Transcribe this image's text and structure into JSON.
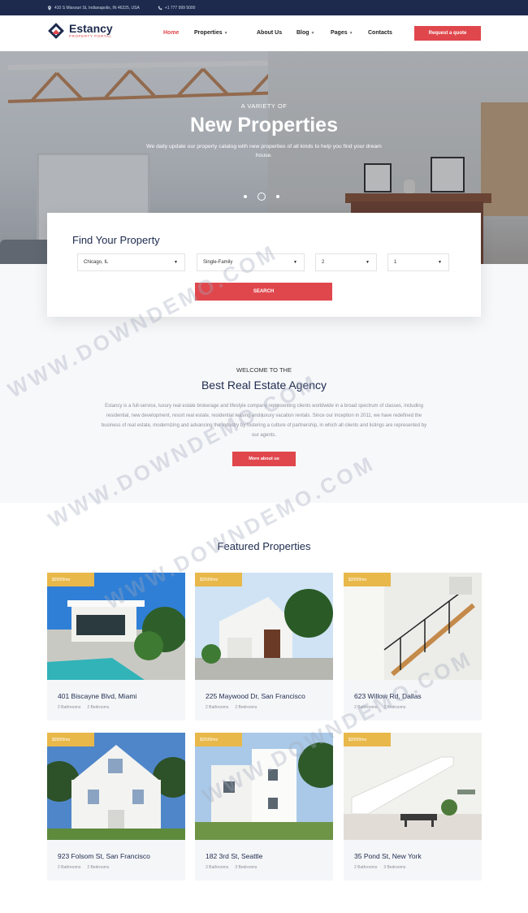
{
  "topbar": {
    "address": "410 S Missouri St, Indianapolis, IN 46225, USA",
    "phone": "+1 777 999 5000"
  },
  "header": {
    "logo_name": "Estancy",
    "logo_sub": "PROPERTY PORTAL",
    "nav": [
      {
        "label": "Home",
        "active": true,
        "dropdown": false
      },
      {
        "label": "Properties",
        "active": false,
        "dropdown": true
      },
      {
        "label": "About Us",
        "active": false,
        "dropdown": false
      },
      {
        "label": "Blog",
        "active": false,
        "dropdown": true
      },
      {
        "label": "Pages",
        "active": false,
        "dropdown": true
      },
      {
        "label": "Contacts",
        "active": false,
        "dropdown": false
      }
    ],
    "cta_label": "Request a quote"
  },
  "hero": {
    "eyebrow": "A VARIETY OF",
    "title": "New Properties",
    "description": "We daily update our property catalog with new properties of all kinds to help you find your dream house."
  },
  "search": {
    "title": "Find Your Property",
    "selects": [
      {
        "value": "Chicago, IL"
      },
      {
        "value": "Single-Family"
      },
      {
        "value": "2"
      },
      {
        "value": "1"
      }
    ],
    "button_label": "SEARCH"
  },
  "welcome": {
    "eyebrow": "WELCOME TO THE",
    "title": "Best Real Estate Agency",
    "text": "Estancy is a full-service, luxury real estate brokerage and lifestyle company representing clients worldwide in a broad spectrum of classes, including residential, new development, resort real estate, residential leasing and luxury vacation rentals. Since our inception in 2011, we have redefined the business of real estate, modernizing and advancing the industry by fostering a culture of partnership, in which all clients and listings are represented by our agents.",
    "button_label": "More about us"
  },
  "featured": {
    "title": "Featured Properties",
    "cards": [
      {
        "price": "$2000/mo",
        "address": "401 Biscayne Blvd, Miami",
        "baths": "2 Bathrooms",
        "beds": "2 Bedrooms"
      },
      {
        "price": "$2000/mo",
        "address": "225 Maywood Dr, San Francisco",
        "baths": "2 Bathrooms",
        "beds": "2 Bedrooms"
      },
      {
        "price": "$2000/mo",
        "address": "623 Willow Rd, Dallas",
        "baths": "2 Bathrooms",
        "beds": "2 Bedrooms"
      },
      {
        "price": "$2000/mo",
        "address": "923 Folsom St, San Francisco",
        "baths": "2 Bathrooms",
        "beds": "2 Bedrooms"
      },
      {
        "price": "$2000/mo",
        "address": "182 3rd St, Seattle",
        "baths": "3 Bathrooms",
        "beds": "3 Bedrooms"
      },
      {
        "price": "$2000/mo",
        "address": "35 Pond St, New York",
        "baths": "2 Bathrooms",
        "beds": "3 Bedrooms"
      }
    ]
  },
  "watermark": "WWW.DOWNDEMO.COM",
  "colors": {
    "navy": "#1d2a4d",
    "accent": "#e0474c",
    "price_tag": "#e8b84a"
  }
}
